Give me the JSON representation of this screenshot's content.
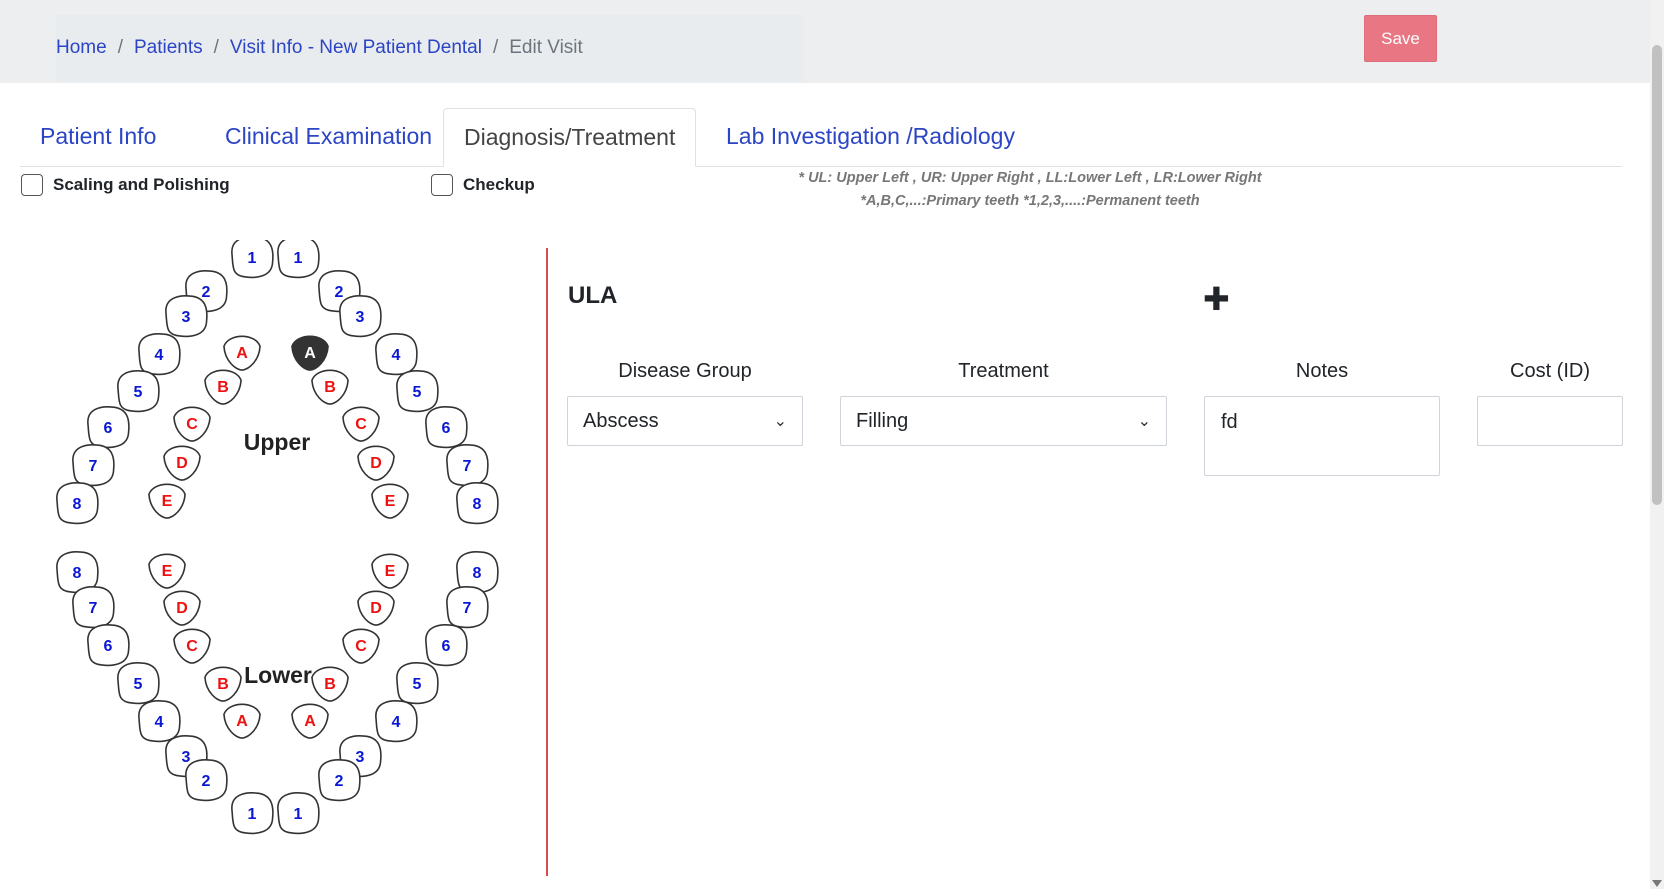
{
  "breadcrumb": {
    "home": "Home",
    "patients": "Patients",
    "visit_info": "Visit Info - New Patient Dental",
    "current": "Edit Visit",
    "separator": "/"
  },
  "toolbar": {
    "save_label": "Save"
  },
  "tabs": [
    {
      "label": "Patient Info",
      "active": false
    },
    {
      "label": "Clinical Examination",
      "active": false
    },
    {
      "label": "Diagnosis/Treatment",
      "active": true
    },
    {
      "label": "Lab Investigation /Radiology",
      "active": false
    }
  ],
  "options": {
    "scaling": {
      "label": "Scaling and Polishing",
      "checked": false
    },
    "checkup": {
      "label": "Checkup",
      "checked": false
    }
  },
  "legend": {
    "line1": "* UL: Upper Left , UR: Upper Right , LL:Lower Left , LR:Lower Right",
    "line2": "*A,B,C,...:Primary teeth *1,2,3,....:Permanent teeth"
  },
  "chart": {
    "upper_label": "Upper",
    "lower_label": "Lower",
    "selected_tooth": "ULA",
    "colors": {
      "permanent": "#0a17d4",
      "primary": "#ee1111",
      "selected_fill": "#333333"
    },
    "upper_left_permanent": [
      "1",
      "2",
      "3",
      "4",
      "5",
      "6",
      "7",
      "8"
    ],
    "upper_right_permanent": [
      "1",
      "2",
      "3",
      "4",
      "5",
      "6",
      "7",
      "8"
    ],
    "upper_left_primary": [
      "A",
      "B",
      "C",
      "D",
      "E"
    ],
    "upper_right_primary": [
      "A",
      "B",
      "C",
      "D",
      "E"
    ],
    "lower_left_permanent": [
      "8",
      "7",
      "6",
      "5",
      "4",
      "3",
      "2",
      "1"
    ],
    "lower_right_permanent": [
      "8",
      "7",
      "6",
      "5",
      "4",
      "3",
      "2",
      "1"
    ],
    "lower_left_primary": [
      "E",
      "D",
      "C",
      "B",
      "A"
    ],
    "lower_right_primary": [
      "E",
      "D",
      "C",
      "B",
      "A"
    ]
  },
  "treatment_form": {
    "title": "ULA",
    "add_icon": "plus-icon",
    "disease_group_label": "Disease Group",
    "disease_group_value": "Abscess",
    "treatment_label": "Treatment",
    "treatment_value": "Filling",
    "notes_label": "Notes",
    "notes_value": "fd",
    "cost_label": "Cost (ID)",
    "cost_value": ""
  }
}
